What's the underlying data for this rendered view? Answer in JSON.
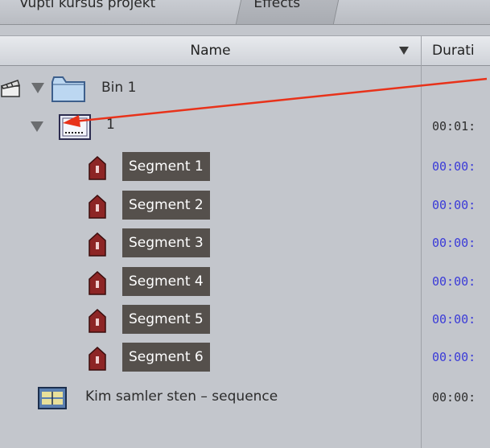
{
  "tabs": {
    "project": "Vupti kursus projekt",
    "effects": "Effects"
  },
  "columns": {
    "name": "Name",
    "duration": "Durati"
  },
  "rows": {
    "bin": {
      "label": "Bin 1"
    },
    "sequence_item": {
      "label": "1",
      "duration": "00:01:"
    },
    "segments": [
      {
        "label": "Segment 1",
        "duration": "00:00:"
      },
      {
        "label": "Segment 2",
        "duration": "00:00:"
      },
      {
        "label": "Segment 3",
        "duration": "00:00:"
      },
      {
        "label": "Segment 4",
        "duration": "00:00:"
      },
      {
        "label": "Segment 5",
        "duration": "00:00:"
      },
      {
        "label": "Segment 6",
        "duration": "00:00:"
      }
    ],
    "sequence": {
      "label": "Kim samler sten – sequence",
      "duration": "00:00:"
    }
  },
  "colors": {
    "annotation_arrow": "#e8321a",
    "segment_label_bg": "#55504c",
    "segment_duration_text": "#3b3bd8",
    "background": "#c3c6cc"
  },
  "icons": {
    "clapper": "clapperboard-icon",
    "bin": "folder-icon",
    "clip": "clip-icon",
    "marker": "segment-marker-icon",
    "sequence": "sequence-icon"
  }
}
